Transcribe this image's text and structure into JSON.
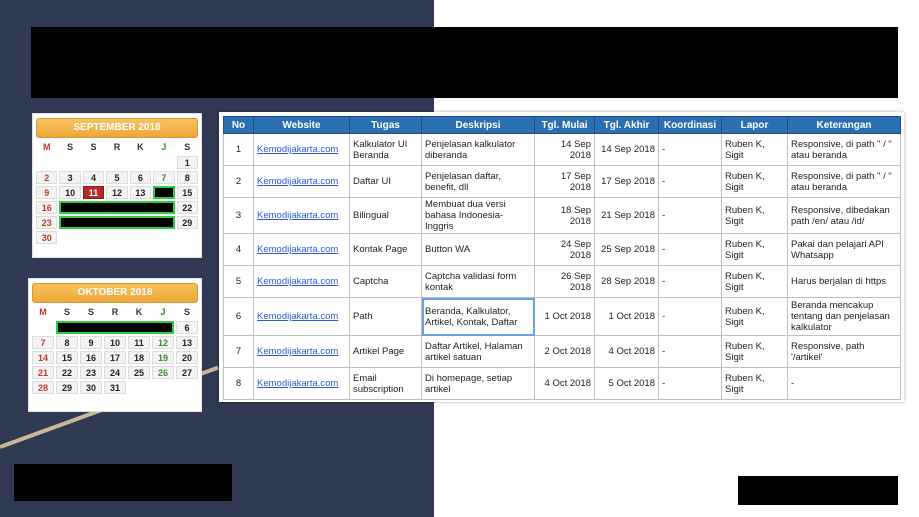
{
  "colors": {
    "background_left": "#2f3a52",
    "table_header": "#2b6fb2",
    "calendar_header": "#eea73a",
    "today_highlight": "#b52a2a",
    "blackout_border": "#2ecc40"
  },
  "calendars": {
    "september": {
      "title": "SEPTEMBER 2018",
      "weekdays": [
        "M",
        "S",
        "S",
        "R",
        "K",
        "J",
        "S"
      ],
      "weeks": [
        [
          "",
          "",
          "",
          "",
          "",
          "",
          "1"
        ],
        [
          "2",
          "3",
          "4",
          "5",
          "6",
          "7",
          "8"
        ],
        [
          "9",
          "10",
          "11",
          "12",
          "13",
          "",
          "15"
        ],
        [
          "16",
          "",
          "",
          "",
          "",
          "",
          "22"
        ],
        [
          "23",
          "",
          "",
          "",
          "",
          "",
          "29"
        ],
        [
          "30",
          "",
          "",
          "",
          "",
          "",
          ""
        ]
      ]
    },
    "october": {
      "title": "OKTOBER 2018",
      "weekdays": [
        "M",
        "S",
        "S",
        "R",
        "K",
        "J",
        "S"
      ],
      "weeks": [
        [
          "",
          "",
          "",
          "",
          "",
          "",
          "6"
        ],
        [
          "7",
          "8",
          "9",
          "10",
          "11",
          "12",
          "13"
        ],
        [
          "14",
          "15",
          "16",
          "17",
          "18",
          "19",
          "20"
        ],
        [
          "21",
          "22",
          "23",
          "24",
          "25",
          "26",
          "27"
        ],
        [
          "28",
          "29",
          "30",
          "31",
          "",
          "",
          ""
        ]
      ]
    }
  },
  "table": {
    "headers": [
      "No",
      "Website",
      "Tugas",
      "Deskripsi",
      "Tgl. Mulai",
      "Tgl. Akhir",
      "Koordinasi",
      "Lapor",
      "Keterangan"
    ],
    "rows": [
      {
        "no": "1",
        "website": "Kemodijakarta.com",
        "tugas": "Kalkulator UI Beranda",
        "deskripsi": "Penjelasan kalkulator diberanda",
        "mulai": "14 Sep 2018",
        "akhir": "14 Sep 2018",
        "koordinasi": "-",
        "lapor": "Ruben K, Sigit",
        "keterangan": "Responsive, di path \" / \" atau beranda"
      },
      {
        "no": "2",
        "website": "Kemodijakarta.com",
        "tugas": "Daftar UI",
        "deskripsi": "Penjelasan daftar, benefit, dll",
        "mulai": "17 Sep 2018",
        "akhir": "17 Sep 2018",
        "koordinasi": "-",
        "lapor": "Ruben K, Sigit",
        "keterangan": "Responsive, di path \" / \" atau beranda"
      },
      {
        "no": "3",
        "website": "Kemodijakarta.com",
        "tugas": "Bilingual",
        "deskripsi": "Membuat dua versi bahasa Indonesia-Inggris",
        "mulai": "18 Sep 2018",
        "akhir": "21 Sep 2018",
        "koordinasi": "-",
        "lapor": "Ruben K, Sigit",
        "keterangan": "Responsive, dibedakan path  /en/  atau /id/"
      },
      {
        "no": "4",
        "website": "Kemodijakarta.com",
        "tugas": "Kontak Page",
        "deskripsi": "Button WA",
        "mulai": "24 Sep 2018",
        "akhir": "25 Sep 2018",
        "koordinasi": "-",
        "lapor": "Ruben K, Sigit",
        "keterangan": "Pakai dan pelajari API Whatsapp"
      },
      {
        "no": "5",
        "website": "Kemodijakarta.com",
        "tugas": "Captcha",
        "deskripsi": "Captcha validasi form kontak",
        "mulai": "26 Sep 2018",
        "akhir": "28 Sep 2018",
        "koordinasi": "-",
        "lapor": "Ruben K, Sigit",
        "keterangan": "Harus berjalan di https"
      },
      {
        "no": "6",
        "website": "Kemodijakarta.com",
        "tugas": "Path",
        "deskripsi": "Beranda, Kalkulator, Artikel, Kontak, Daftar",
        "mulai": "1 Oct 2018",
        "akhir": "1 Oct 2018",
        "koordinasi": "-",
        "lapor": "Ruben K, Sigit",
        "keterangan": "Beranda mencakup tentang dan penjelasan kalkulator"
      },
      {
        "no": "7",
        "website": "Kemodijakarta.com",
        "tugas": "Artikel Page",
        "deskripsi": "Daftar Artikel, Halaman artikel satuan",
        "mulai": "2 Oct 2018",
        "akhir": "4 Oct 2018",
        "koordinasi": "-",
        "lapor": "Ruben K, Sigit",
        "keterangan": "Responsive, path '/artikel'"
      },
      {
        "no": "8",
        "website": "Kemodijakarta.com",
        "tugas": "Email subscription",
        "deskripsi": "Di homepage, setiap artikel",
        "mulai": "4 Oct 2018",
        "akhir": "5 Oct 2018",
        "koordinasi": "-",
        "lapor": "Ruben K, Sigit",
        "keterangan": "-"
      }
    ]
  }
}
